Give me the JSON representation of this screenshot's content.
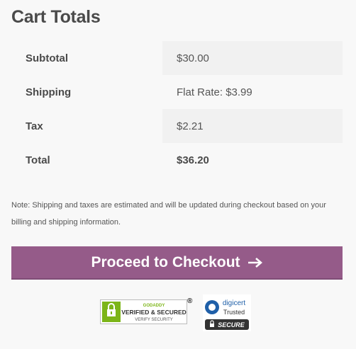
{
  "cart": {
    "title": "Cart Totals",
    "rows": [
      {
        "label": "Subtotal",
        "value": "$30.00"
      },
      {
        "label": "Shipping",
        "value": "Flat Rate: $3.99"
      },
      {
        "label": "Tax",
        "value": "$2.21"
      },
      {
        "label": "Total",
        "value": "$36.20"
      }
    ],
    "note": "Note: Shipping and taxes are estimated and will be updated during checkout based on your billing and shipping information.",
    "checkout_label": "Proceed to Checkout"
  },
  "badges": {
    "godaddy": {
      "brand": "GODADDY",
      "line1": "VERIFIED & SECURED",
      "line2": "VERIFY SECURITY",
      "mark": "®"
    },
    "digicert": {
      "brand": "digicert",
      "line1": "Trusted",
      "line2": "SECURE"
    }
  },
  "colors": {
    "accent": "#955b89",
    "background": "#f8f8f8"
  }
}
